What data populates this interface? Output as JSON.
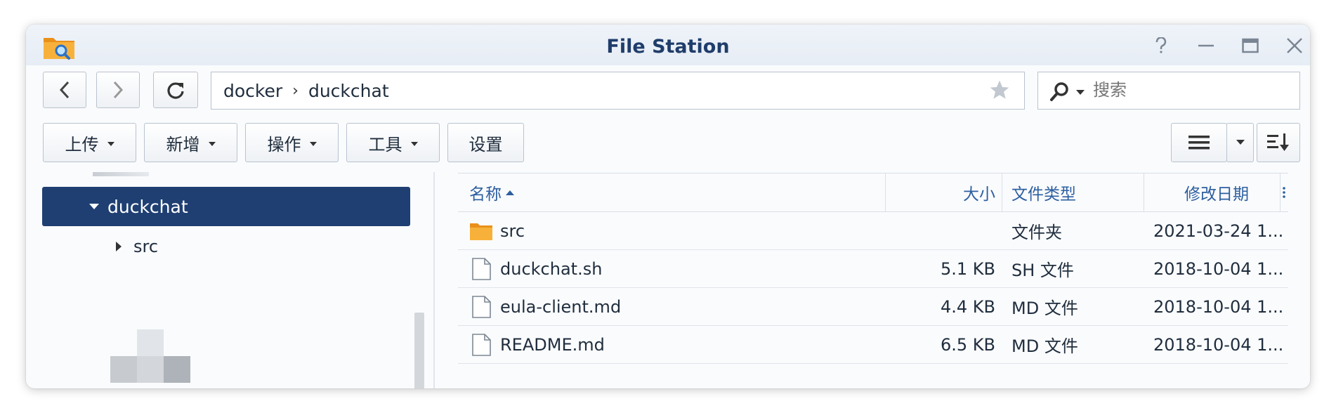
{
  "window": {
    "title": "File Station"
  },
  "path": {
    "segments": [
      "docker",
      "duckchat"
    ]
  },
  "search": {
    "placeholder": "搜索"
  },
  "toolbar": {
    "upload_label": "上传",
    "create_label": "新增",
    "action_label": "操作",
    "tools_label": "工具",
    "settings_label": "设置"
  },
  "tree": {
    "selected_label": "duckchat",
    "child_label": "src"
  },
  "table": {
    "columns": {
      "name": "名称",
      "size": "大小",
      "type": "文件类型",
      "modified": "修改日期"
    },
    "rows": [
      {
        "icon": "folder-icon",
        "name": "src",
        "size": "",
        "type": "文件夹",
        "modified": "2021-03-24 1..."
      },
      {
        "icon": "file-icon",
        "name": "duckchat.sh",
        "size": "5.1 KB",
        "type": "SH 文件",
        "modified": "2018-10-04 1..."
      },
      {
        "icon": "file-icon",
        "name": "eula-client.md",
        "size": "4.4 KB",
        "type": "MD 文件",
        "modified": "2018-10-04 1..."
      },
      {
        "icon": "file-icon",
        "name": "README.md",
        "size": "6.5 KB",
        "type": "MD 文件",
        "modified": "2018-10-04 1..."
      }
    ]
  },
  "colors": {
    "accent": "#1f3f73",
    "header_text": "#2d5fa0",
    "folder": "#f5a623"
  }
}
